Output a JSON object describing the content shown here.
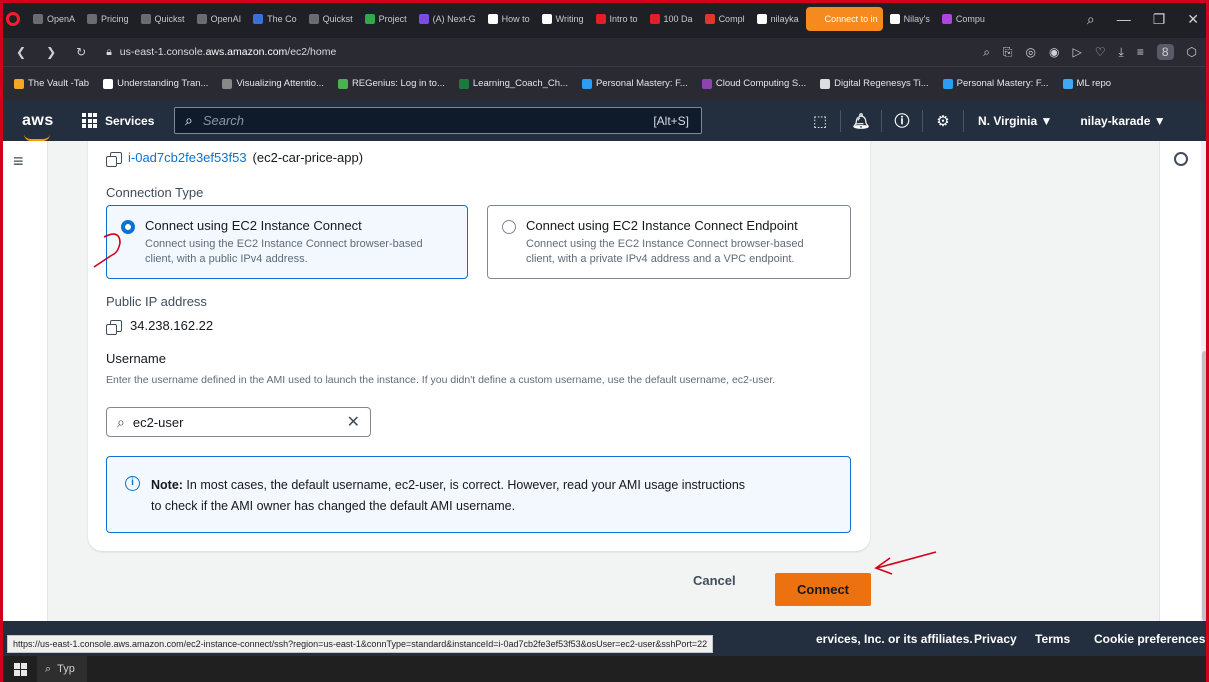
{
  "browser": {
    "tabs": [
      {
        "label": "OpenA",
        "color": "#6b6b74"
      },
      {
        "label": "Pricing",
        "color": "#6b6b74"
      },
      {
        "label": "Quickst",
        "color": "#6b6b74"
      },
      {
        "label": "OpenAI",
        "color": "#6b6b74"
      },
      {
        "label": "The Co",
        "color": "#3b6fd9"
      },
      {
        "label": "Quickst",
        "color": "#6b6b74"
      },
      {
        "label": "Project",
        "color": "#2eaa4a"
      },
      {
        "label": "(A) Next-G",
        "color": "#7a4de0"
      },
      {
        "label": "How to",
        "color": "#ffffff"
      },
      {
        "label": "Writing",
        "color": "#ffffff"
      },
      {
        "label": "Intro to",
        "color": "#e21f26"
      },
      {
        "label": "100 Da",
        "color": "#e21f26"
      },
      {
        "label": "Compl",
        "color": "#e2362c"
      },
      {
        "label": "nilayka",
        "color": "#ffffff"
      },
      {
        "label": "Connect to in",
        "color": "#f58a1f",
        "active": true
      },
      {
        "label": "Nilay's",
        "color": "#ffffff"
      },
      {
        "label": "Compu",
        "color": "#b044e0"
      }
    ],
    "url_prefix": "us-east-1.console.",
    "url_domain": "aws.amazon.com",
    "url_path": "/ec2/home",
    "profile_badge": "8",
    "bookmarks": [
      {
        "label": "The Vault -Tab",
        "color": "#f5a623"
      },
      {
        "label": "Understanding Tran...",
        "color": "#ffffff"
      },
      {
        "label": "Visualizing Attentio...",
        "color": "#888888"
      },
      {
        "label": "REGenius: Log in to...",
        "color": "#4caf50"
      },
      {
        "label": "Learning_Coach_Ch...",
        "color": "#1d7a3d"
      },
      {
        "label": "Personal Mastery: F...",
        "color": "#2a9df4"
      },
      {
        "label": "Cloud Computing S...",
        "color": "#8e44ad"
      },
      {
        "label": "Digital Regenesys Ti...",
        "color": "#dddddd"
      },
      {
        "label": "Personal Mastery: F...",
        "color": "#2a9df4"
      },
      {
        "label": "ML repo",
        "color": "#3fa9f5"
      }
    ]
  },
  "aws_nav": {
    "logo": "aws",
    "services": "Services",
    "search_placeholder": "Search",
    "search_shortcut": "[Alt+S]",
    "region": "N. Virginia ▼",
    "account": "nilay-karade ▼"
  },
  "instance": {
    "id": "i-0ad7cb2fe3ef53f53",
    "name": "(ec2-car-price-app)"
  },
  "connection_type": {
    "label": "Connection Type",
    "options": [
      {
        "title": "Connect using EC2 Instance Connect",
        "desc_line1": "Connect using the EC2 Instance Connect browser-based",
        "desc_line2": "client, with a public IPv4 address.",
        "selected": true
      },
      {
        "title": "Connect using EC2 Instance Connect Endpoint",
        "desc_line1": "Connect using the EC2 Instance Connect browser-based",
        "desc_line2": "client, with a private IPv4 address and a VPC endpoint.",
        "selected": false
      }
    ]
  },
  "public_ip": {
    "label": "Public IP address",
    "value": "34.238.162.22"
  },
  "username": {
    "label": "Username",
    "help": "Enter the username defined in the AMI used to launch the instance. If you didn't define a custom username, use the default username, ec2-user.",
    "value": "ec2-user"
  },
  "note": {
    "bold": "Note:",
    "text_line1": " In most cases, the default username, ec2-user, is correct. However, read your AMI usage instructions",
    "text_line2": "to check if the AMI owner has changed the default AMI username."
  },
  "actions": {
    "cancel": "Cancel",
    "connect": "Connect"
  },
  "footer": {
    "copyright": "ervices, Inc. or its affiliates.",
    "privacy": "Privacy",
    "terms": "Terms",
    "cookie": "Cookie preferences"
  },
  "status_bar_url": "https://us-east-1.console.aws.amazon.com/ec2-instance-connect/ssh?region=us-east-1&connType=standard&instanceId=i-0ad7cb2fe3ef53f53&osUser=ec2-user&sshPort=22",
  "taskbar": {
    "search_text": "Typ"
  },
  "colors": {
    "aws_orange": "#ec7211",
    "aws_navy": "#232f3e",
    "link_blue": "#0972d3",
    "annotation_red": "#d0021b"
  }
}
